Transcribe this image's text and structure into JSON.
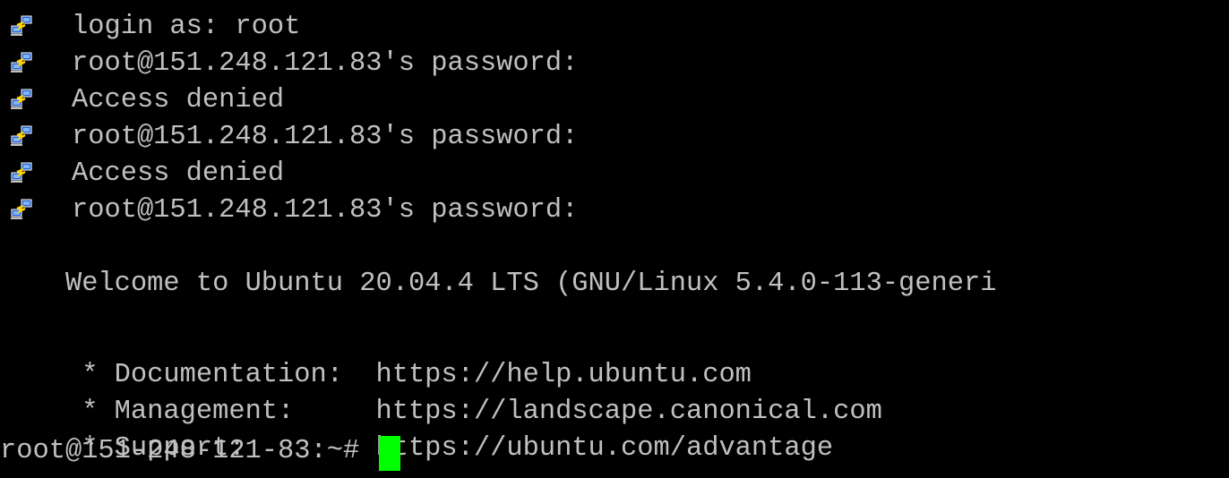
{
  "terminal": {
    "colors": {
      "background": "#000000",
      "foreground": "#c0c0c0",
      "cursor": "#00ff00"
    },
    "system_messages": [
      {
        "icon": "putty-session-icon",
        "text": "login as: root"
      },
      {
        "icon": "putty-session-icon",
        "text": "root@151.248.121.83's password:"
      },
      {
        "icon": "putty-session-icon",
        "text": "Access denied"
      },
      {
        "icon": "putty-session-icon",
        "text": "root@151.248.121.83's password:"
      },
      {
        "icon": "putty-session-icon",
        "text": "Access denied"
      },
      {
        "icon": "putty-session-icon",
        "text": "root@151.248.121.83's password:"
      }
    ],
    "welcome": "Welcome to Ubuntu 20.04.4 LTS (GNU/Linux 5.4.0-113-generi",
    "blank": "",
    "info_lines": [
      " * Documentation:  https://help.ubuntu.com",
      " * Management:     https://landscape.canonical.com",
      " * Support:        https://ubuntu.com/advantage"
    ],
    "prompt": "root@151-248-121-83:~#"
  }
}
